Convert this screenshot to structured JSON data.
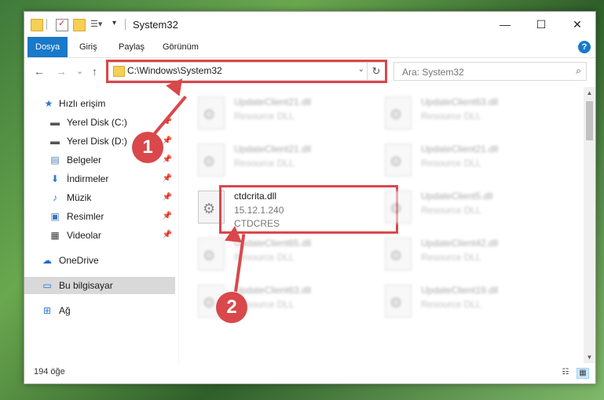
{
  "window": {
    "title": "System32",
    "controls": {
      "minimize": "—",
      "maximize": "☐",
      "close": "✕"
    }
  },
  "ribbon": {
    "tabs": [
      {
        "label": "Dosya",
        "active": true
      },
      {
        "label": "Giriş"
      },
      {
        "label": "Paylaş"
      },
      {
        "label": "Görünüm"
      }
    ],
    "help": "?"
  },
  "nav": {
    "back": "←",
    "forward": "→",
    "recent": "⌄",
    "up": "↑",
    "address": "C:\\Windows\\System32",
    "address_dropdown": "⌄",
    "refresh": "↻",
    "search_placeholder": "Ara: System32",
    "search_icon": "⌕"
  },
  "sidebar": {
    "items": [
      {
        "label": "Hızlı erişim",
        "icon": "★",
        "icon_name": "star-icon",
        "color": "#2b78d0"
      },
      {
        "label": "Yerel Disk (C:)",
        "icon": "▬",
        "icon_name": "drive-icon",
        "color": "#555555",
        "pinned": true
      },
      {
        "label": "Yerel Disk (D:)",
        "icon": "▬",
        "icon_name": "drive-icon",
        "color": "#555555",
        "pinned": true
      },
      {
        "label": "Belgeler",
        "icon": "▤",
        "icon_name": "documents-icon",
        "color": "#4a7fb5",
        "pinned": true
      },
      {
        "label": "İndirmeler",
        "icon": "⬇",
        "icon_name": "downloads-icon",
        "color": "#2b78d0",
        "pinned": true
      },
      {
        "label": "Müzik",
        "icon": "♪",
        "icon_name": "music-icon",
        "color": "#2b78d0",
        "pinned": true
      },
      {
        "label": "Resimler",
        "icon": "▣",
        "icon_name": "pictures-icon",
        "color": "#3a78b5",
        "pinned": true
      },
      {
        "label": "Videolar",
        "icon": "▦",
        "icon_name": "videos-icon",
        "color": "#3a3a3a",
        "pinned": true
      },
      {
        "label": "OneDrive",
        "icon": "☁",
        "icon_name": "onedrive-icon",
        "color": "#1f6fcf"
      },
      {
        "label": "Bu bilgisayar",
        "icon": "▭",
        "icon_name": "computer-icon",
        "color": "#1f6fcf",
        "selected": true
      },
      {
        "label": "Ağ",
        "icon": "⊞",
        "icon_name": "network-icon",
        "color": "#2b78d0"
      }
    ],
    "pin": "📌"
  },
  "files": {
    "left": [
      {
        "name": "UpdateClient21.dll",
        "desc": "Resource DLL",
        "blurred": true
      },
      {
        "name": "UpdateClient21.dll",
        "desc": "Resource DLL",
        "blurred": true
      },
      {
        "name": "ctdcrita.dll",
        "version": "15.12.1.240",
        "desc": "CTDCRES",
        "blurred": false
      },
      {
        "name": "UpdateClient65.dll",
        "desc": "Resource DLL",
        "blurred": true
      },
      {
        "name": "UpdateClient63.dll",
        "desc": "Resource DLL",
        "blurred": true
      }
    ],
    "right": [
      {
        "name": "UpdateClient63.dll",
        "desc": "Resource DLL"
      },
      {
        "name": "UpdateClient21.dll",
        "desc": "Resource DLL"
      },
      {
        "name": "UpdateClient5.dll",
        "desc": "Resource DLL"
      },
      {
        "name": "UpdateClient42.dll",
        "desc": "Resource DLL"
      },
      {
        "name": "UpdateClient19.dll",
        "desc": "Resource DLL"
      }
    ]
  },
  "status": {
    "count": "194 öğe"
  },
  "callouts": {
    "one": "1",
    "two": "2"
  },
  "colors": {
    "accent": "#1979ca",
    "highlight": "#d9484b"
  }
}
